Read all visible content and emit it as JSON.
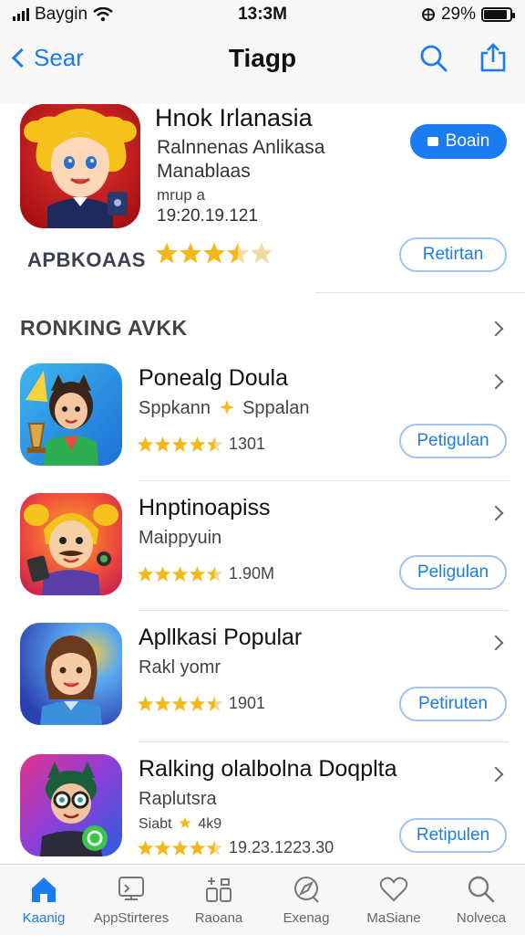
{
  "status_bar": {
    "carrier": "Baygin",
    "time": "13:3M",
    "battery": "29%"
  },
  "nav": {
    "back_label": "Sear",
    "title": "Tiagp"
  },
  "featured": {
    "title": "Hnok Irlanasia",
    "subtitle_line1": "Ralnnenas  Anlikasa",
    "subtitle_line2": "Manablaas",
    "meta": "mrup a",
    "date": "19:20.19.121",
    "developer": "APBKOAAS",
    "rating": 3.5,
    "primary_button": "Boain",
    "secondary_button": "Retirtan"
  },
  "section": {
    "title": "RONKING AVKK"
  },
  "apps": [
    {
      "name": "Ponealg Doula",
      "subtitle": "Sppkann",
      "subtitle_extra": "Sppalan",
      "rating": 4.5,
      "rating_count": "1301",
      "button": "Petigulan"
    },
    {
      "name": "Hnptinoapiss",
      "subtitle": "Maippyuin",
      "rating": 4.5,
      "rating_count": "1.90M",
      "button": "Peligulan"
    },
    {
      "name": "Apllkasi Popular",
      "subtitle": "Rakl yomr",
      "rating": 4.5,
      "rating_count": "1901",
      "button": "Petiruten"
    },
    {
      "name": "Ralking olalbolna Doqplta",
      "subtitle": "Raplutsra",
      "subtitle_extra": "Siabt",
      "subtitle_extra2": "4k9",
      "rating": 4.5,
      "rating_count": "19.23.1223.30",
      "button": "Retipulen"
    }
  ],
  "tabs": [
    {
      "label": "Kaanig",
      "icon": "home-icon",
      "active": true
    },
    {
      "label": "AppStirteres",
      "icon": "apps-icon",
      "active": false
    },
    {
      "label": "Raoana",
      "icon": "games-icon",
      "active": false
    },
    {
      "label": "Exenag",
      "icon": "explore-icon",
      "active": false
    },
    {
      "label": "MaSiane",
      "icon": "heart-icon",
      "active": false
    },
    {
      "label": "Nolveca",
      "icon": "search-icon",
      "active": false
    }
  ],
  "colors": {
    "accent": "#1a7cf0",
    "star": "#f5b81a"
  }
}
